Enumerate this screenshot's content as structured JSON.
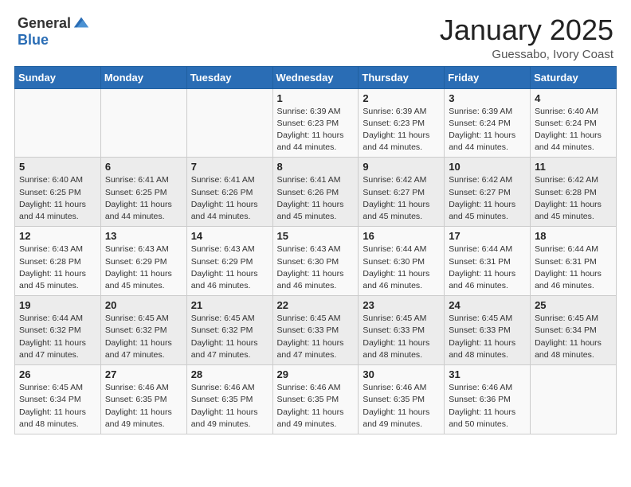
{
  "header": {
    "logo_general": "General",
    "logo_blue": "Blue",
    "month_year": "January 2025",
    "location": "Guessabo, Ivory Coast"
  },
  "days_of_week": [
    "Sunday",
    "Monday",
    "Tuesday",
    "Wednesday",
    "Thursday",
    "Friday",
    "Saturday"
  ],
  "weeks": [
    [
      {
        "day": "",
        "info": ""
      },
      {
        "day": "",
        "info": ""
      },
      {
        "day": "",
        "info": ""
      },
      {
        "day": "1",
        "info": "Sunrise: 6:39 AM\nSunset: 6:23 PM\nDaylight: 11 hours\nand 44 minutes."
      },
      {
        "day": "2",
        "info": "Sunrise: 6:39 AM\nSunset: 6:23 PM\nDaylight: 11 hours\nand 44 minutes."
      },
      {
        "day": "3",
        "info": "Sunrise: 6:39 AM\nSunset: 6:24 PM\nDaylight: 11 hours\nand 44 minutes."
      },
      {
        "day": "4",
        "info": "Sunrise: 6:40 AM\nSunset: 6:24 PM\nDaylight: 11 hours\nand 44 minutes."
      }
    ],
    [
      {
        "day": "5",
        "info": "Sunrise: 6:40 AM\nSunset: 6:25 PM\nDaylight: 11 hours\nand 44 minutes."
      },
      {
        "day": "6",
        "info": "Sunrise: 6:41 AM\nSunset: 6:25 PM\nDaylight: 11 hours\nand 44 minutes."
      },
      {
        "day": "7",
        "info": "Sunrise: 6:41 AM\nSunset: 6:26 PM\nDaylight: 11 hours\nand 44 minutes."
      },
      {
        "day": "8",
        "info": "Sunrise: 6:41 AM\nSunset: 6:26 PM\nDaylight: 11 hours\nand 45 minutes."
      },
      {
        "day": "9",
        "info": "Sunrise: 6:42 AM\nSunset: 6:27 PM\nDaylight: 11 hours\nand 45 minutes."
      },
      {
        "day": "10",
        "info": "Sunrise: 6:42 AM\nSunset: 6:27 PM\nDaylight: 11 hours\nand 45 minutes."
      },
      {
        "day": "11",
        "info": "Sunrise: 6:42 AM\nSunset: 6:28 PM\nDaylight: 11 hours\nand 45 minutes."
      }
    ],
    [
      {
        "day": "12",
        "info": "Sunrise: 6:43 AM\nSunset: 6:28 PM\nDaylight: 11 hours\nand 45 minutes."
      },
      {
        "day": "13",
        "info": "Sunrise: 6:43 AM\nSunset: 6:29 PM\nDaylight: 11 hours\nand 45 minutes."
      },
      {
        "day": "14",
        "info": "Sunrise: 6:43 AM\nSunset: 6:29 PM\nDaylight: 11 hours\nand 46 minutes."
      },
      {
        "day": "15",
        "info": "Sunrise: 6:43 AM\nSunset: 6:30 PM\nDaylight: 11 hours\nand 46 minutes."
      },
      {
        "day": "16",
        "info": "Sunrise: 6:44 AM\nSunset: 6:30 PM\nDaylight: 11 hours\nand 46 minutes."
      },
      {
        "day": "17",
        "info": "Sunrise: 6:44 AM\nSunset: 6:31 PM\nDaylight: 11 hours\nand 46 minutes."
      },
      {
        "day": "18",
        "info": "Sunrise: 6:44 AM\nSunset: 6:31 PM\nDaylight: 11 hours\nand 46 minutes."
      }
    ],
    [
      {
        "day": "19",
        "info": "Sunrise: 6:44 AM\nSunset: 6:32 PM\nDaylight: 11 hours\nand 47 minutes."
      },
      {
        "day": "20",
        "info": "Sunrise: 6:45 AM\nSunset: 6:32 PM\nDaylight: 11 hours\nand 47 minutes."
      },
      {
        "day": "21",
        "info": "Sunrise: 6:45 AM\nSunset: 6:32 PM\nDaylight: 11 hours\nand 47 minutes."
      },
      {
        "day": "22",
        "info": "Sunrise: 6:45 AM\nSunset: 6:33 PM\nDaylight: 11 hours\nand 47 minutes."
      },
      {
        "day": "23",
        "info": "Sunrise: 6:45 AM\nSunset: 6:33 PM\nDaylight: 11 hours\nand 48 minutes."
      },
      {
        "day": "24",
        "info": "Sunrise: 6:45 AM\nSunset: 6:33 PM\nDaylight: 11 hours\nand 48 minutes."
      },
      {
        "day": "25",
        "info": "Sunrise: 6:45 AM\nSunset: 6:34 PM\nDaylight: 11 hours\nand 48 minutes."
      }
    ],
    [
      {
        "day": "26",
        "info": "Sunrise: 6:45 AM\nSunset: 6:34 PM\nDaylight: 11 hours\nand 48 minutes."
      },
      {
        "day": "27",
        "info": "Sunrise: 6:46 AM\nSunset: 6:35 PM\nDaylight: 11 hours\nand 49 minutes."
      },
      {
        "day": "28",
        "info": "Sunrise: 6:46 AM\nSunset: 6:35 PM\nDaylight: 11 hours\nand 49 minutes."
      },
      {
        "day": "29",
        "info": "Sunrise: 6:46 AM\nSunset: 6:35 PM\nDaylight: 11 hours\nand 49 minutes."
      },
      {
        "day": "30",
        "info": "Sunrise: 6:46 AM\nSunset: 6:35 PM\nDaylight: 11 hours\nand 49 minutes."
      },
      {
        "day": "31",
        "info": "Sunrise: 6:46 AM\nSunset: 6:36 PM\nDaylight: 11 hours\nand 50 minutes."
      },
      {
        "day": "",
        "info": ""
      }
    ]
  ]
}
